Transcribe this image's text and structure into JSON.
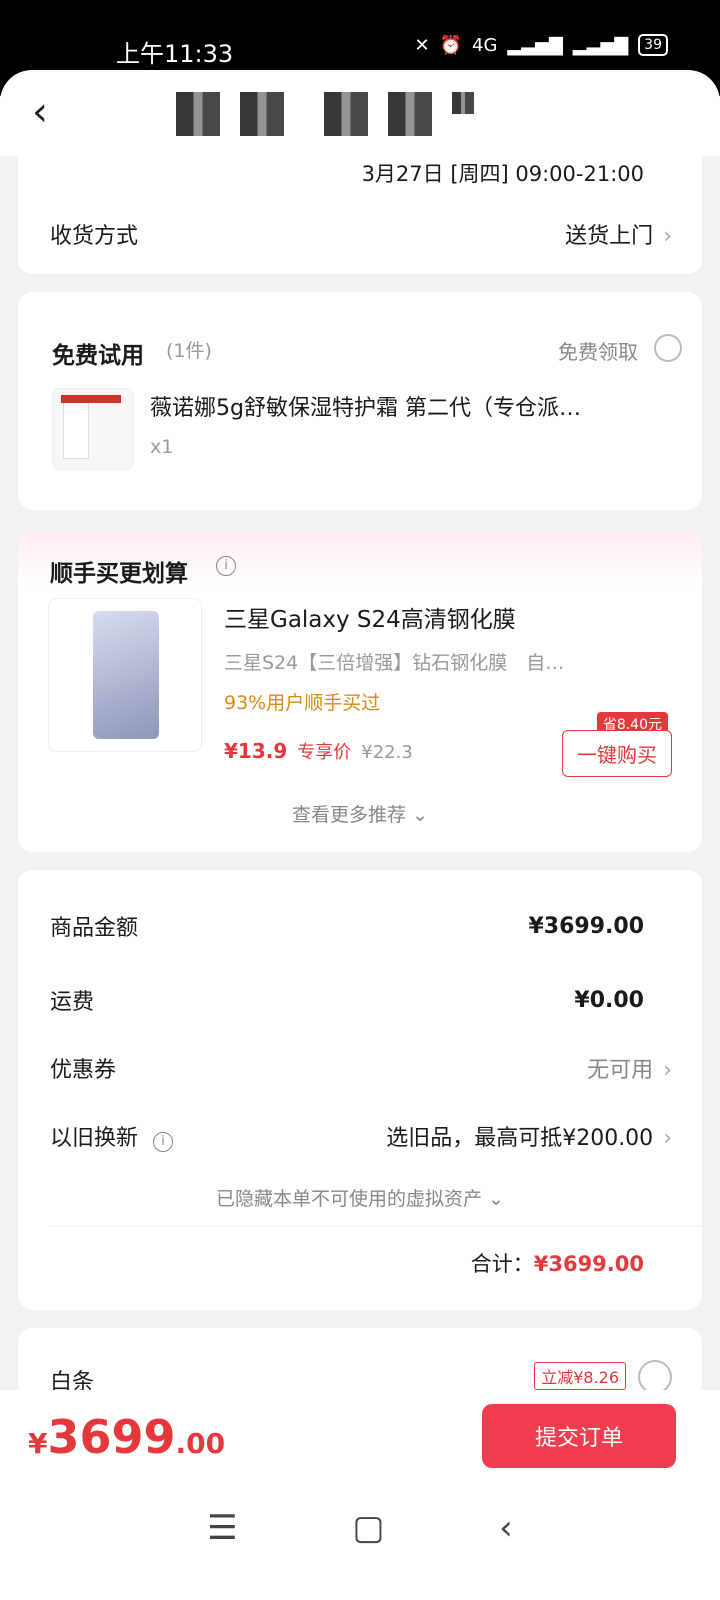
{
  "status": {
    "time": "上午11:33",
    "network": "4G",
    "battery": "39"
  },
  "nav": {
    "back_icon": "back-chevron-icon"
  },
  "delivery": {
    "date_line": "3月27日 [周四] 09:00-21:00",
    "method_label": "收货方式",
    "method_value": "送货上门"
  },
  "trial": {
    "title": "免费试用",
    "count": "(1件)",
    "action": "免费领取",
    "product_name": "薇诺娜5g舒敏保湿特护霜 第二代（专仓派…",
    "qty": "x1"
  },
  "reco": {
    "title": "顺手买更划算",
    "name": "三星Galaxy S24高清钢化膜",
    "desc": "三星S24【三倍增强】钻石钢化膜　自…",
    "popularity": "93%用户顺手买过",
    "price": "¥13.9",
    "price_label": "专享价",
    "orig_price": "¥22.3",
    "save_badge": "省8.40元",
    "buy_label": "一键购买",
    "more": "查看更多推荐"
  },
  "summary": {
    "goods_label": "商品金额",
    "goods_value": "¥3699.00",
    "shipping_label": "运费",
    "shipping_value": "¥0.00",
    "coupon_label": "优惠券",
    "coupon_value": "无可用",
    "tradein_label": "以旧换新",
    "tradein_value": "选旧品，最高可抵¥200.00",
    "hidden_assets": "已隐藏本单不可使用的虚拟资产",
    "total_label": "合计：",
    "total_value": "¥3699.00"
  },
  "payment": {
    "method": "白条",
    "discount": "立减¥8.26"
  },
  "bottom": {
    "currency": "¥",
    "amount_int": "3699",
    "amount_dec": ".00",
    "submit": "提交订单"
  },
  "colors": {
    "accent": "#e4393c",
    "submit": "#f23c4f"
  }
}
